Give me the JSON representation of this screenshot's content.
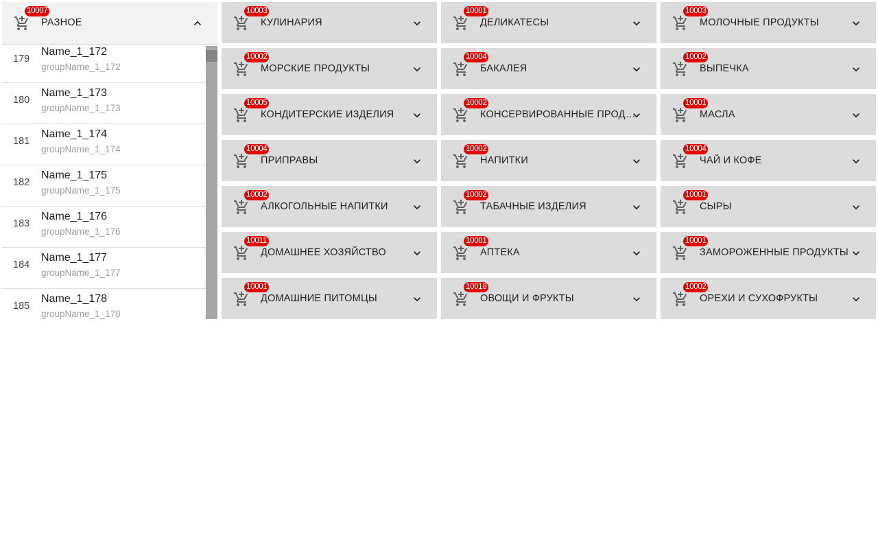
{
  "open_category": {
    "label": "РАЗНОЕ",
    "count": "10007",
    "icon": "cart-add-icon",
    "chevron": "chevron-up-icon"
  },
  "items": [
    {
      "num": "179",
      "name": "Name_1_172",
      "group": "groupName_1_172"
    },
    {
      "num": "180",
      "name": "Name_1_173",
      "group": "groupName_1_173"
    },
    {
      "num": "181",
      "name": "Name_1_174",
      "group": "groupName_1_174"
    },
    {
      "num": "182",
      "name": "Name_1_175",
      "group": "groupName_1_175"
    },
    {
      "num": "183",
      "name": "Name_1_176",
      "group": "groupName_1_176"
    },
    {
      "num": "184",
      "name": "Name_1_177",
      "group": "groupName_1_177"
    },
    {
      "num": "185",
      "name": "Name_1_178",
      "group": "groupName_1_178"
    }
  ],
  "categories": [
    {
      "label": "КУЛИНАРИЯ",
      "count": "10003"
    },
    {
      "label": "ДЕЛИКАТЕСЫ",
      "count": "10001"
    },
    {
      "label": "МОЛОЧНЫЕ ПРОДУКТЫ",
      "count": "10003"
    },
    {
      "label": "МОРСКИЕ ПРОДУКТЫ",
      "count": "10002"
    },
    {
      "label": "БАКАЛЕЯ",
      "count": "10004"
    },
    {
      "label": "ВЫПЕЧКА",
      "count": "10002"
    },
    {
      "label": "КОНДИТЕРСКИЕ ИЗДЕЛИЯ",
      "count": "10005"
    },
    {
      "label": "КОНСЕРВИРОВАННЫЕ ПРОДУКТЫ",
      "count": "10002"
    },
    {
      "label": "МАСЛА",
      "count": "10001"
    },
    {
      "label": "ПРИПРАВЫ",
      "count": "10004"
    },
    {
      "label": "НАПИТКИ",
      "count": "10002"
    },
    {
      "label": "ЧАЙ И КОФЕ",
      "count": "10004"
    },
    {
      "label": "АЛКОГОЛЬНЫЕ НАПИТКИ",
      "count": "10002"
    },
    {
      "label": "ТАБАЧНЫЕ ИЗДЕЛИЯ",
      "count": "10002"
    },
    {
      "label": "СЫРЫ",
      "count": "10001"
    },
    {
      "label": "ДОМАШНЕЕ ХОЗЯЙСТВО",
      "count": "10011"
    },
    {
      "label": "АПТЕКА",
      "count": "10001"
    },
    {
      "label": "ЗАМОРОЖЕННЫЕ ПРОДУКТЫ",
      "count": "10001"
    },
    {
      "label": "ДОМАШНИЕ ПИТОМЦЫ",
      "count": "10001"
    },
    {
      "label": "ОВОЩИ И ФРУКТЫ",
      "count": "10018"
    },
    {
      "label": "ОРЕХИ И СУХОФРУКТЫ",
      "count": "10002"
    }
  ],
  "colors": {
    "badge": "#e60000",
    "tile": "#dcdcdc",
    "tile_open": "#f2f2f2",
    "scrollbar": "#a6a6a6"
  }
}
